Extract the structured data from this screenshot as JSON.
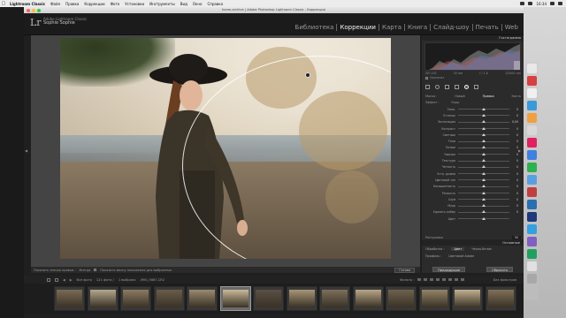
{
  "menubar": {
    "app": "Lightroom Classic",
    "items": [
      "Файл",
      "Правка",
      "Коррекции",
      "Фото",
      "Установки",
      "Инструменты",
      "Вид",
      "Окно",
      "Справка"
    ],
    "clock": "16:34"
  },
  "window": {
    "title": "home-archive | Adobe Photoshop Lightroom Classic - Коррекции"
  },
  "identity": {
    "line1": "Adobe Lightroom Classic",
    "line2": "Sophie Sophie",
    "logo": "Lr"
  },
  "modules": [
    {
      "label": "Библиотека",
      "active": false
    },
    {
      "label": "Коррекции",
      "active": true
    },
    {
      "label": "Карта",
      "active": false
    },
    {
      "label": "Книга",
      "active": false
    },
    {
      "label": "Слайд-шоу",
      "active": false
    },
    {
      "label": "Печать",
      "active": false
    },
    {
      "label": "Web",
      "active": false
    }
  ],
  "panel": {
    "histogram_title": "Гистограмма",
    "readout": [
      "ISO 100",
      "50 мм",
      "f / 1,8",
      "1/2000 сек"
    ],
    "original_photo": "Оригинал",
    "mask_label": "Маска :",
    "mask_tabs": [
      "Новый",
      "Правка",
      "Кисть"
    ],
    "effect_label": "Эффект :",
    "effect_value": "Корр.",
    "sliders": [
      {
        "label": "Темп.",
        "value": "0",
        "pos": 0.5
      },
      {
        "label": "Оттенок",
        "value": "0",
        "pos": 0.5
      },
      {
        "label": "Экспозиция",
        "value": "0,00",
        "pos": 0.5
      },
      {
        "label": "Контраст",
        "value": "0",
        "pos": 0.5
      },
      {
        "label": "Светлые",
        "value": "0",
        "pos": 0.5
      },
      {
        "label": "Тени",
        "value": "0",
        "pos": 0.5
      },
      {
        "label": "Белые",
        "value": "0",
        "pos": 0.5
      },
      {
        "label": "Черные",
        "value": "0",
        "pos": 0.5
      },
      {
        "label": "Текстура",
        "value": "0",
        "pos": 0.5
      },
      {
        "label": "Четкость",
        "value": "0",
        "pos": 0.5
      },
      {
        "label": "Устр. дымки",
        "value": "0",
        "pos": 0.5
      },
      {
        "label": "Цветовой тон",
        "value": "0",
        "pos": 0.5
      },
      {
        "label": "Насыщенность",
        "value": "0",
        "pos": 0.5
      },
      {
        "label": "Резкость",
        "value": "0",
        "pos": 0.5
      },
      {
        "label": "Шум",
        "value": "0",
        "pos": 0.5
      },
      {
        "label": "Муар",
        "value": "0",
        "pos": 0.5
      },
      {
        "label": "Удалить кайму",
        "value": "0",
        "pos": 0.5
      },
      {
        "label": "Цвет",
        "value": "",
        "pos": 0.5
      }
    ],
    "feather_label": "Растушевка",
    "feather_value": "50",
    "invert_label": "Инвертировать маску",
    "range_label": "Range Mask :",
    "range_value": "Off",
    "reset_label": "Сброс",
    "close_label": "Закрыть",
    "basic_title": "Основные",
    "treatment_label": "Обработка :",
    "treatment_color": "Цвет",
    "treatment_bw": "Черно-белое",
    "profile_label": "Профиль :",
    "profile_value": "Цветовой Adobe"
  },
  "bottom_buttons": {
    "previous": "Предыдущие",
    "reset": "Сбросить"
  },
  "toolbar": {
    "show_edit_pins": "Показать значки правки :",
    "pins_value": "Всегда",
    "overlay": "Показать маску наложения для выбранных",
    "done": "Готово"
  },
  "filmstrip": {
    "crumb_all": "Все фото",
    "crumb_count": "121 фото /",
    "crumb_selected": "1 выбрано",
    "crumb_file": "/IMG_5667.CR2",
    "filter_label": "Фильтр :",
    "filter_off": "Без фильтров",
    "thumbs": 14,
    "selected_index": 5
  },
  "colors": {
    "active_module": "#f2f2f2",
    "panel_bg": "#2b2b2b",
    "mask_overlay": "#ffffff"
  }
}
